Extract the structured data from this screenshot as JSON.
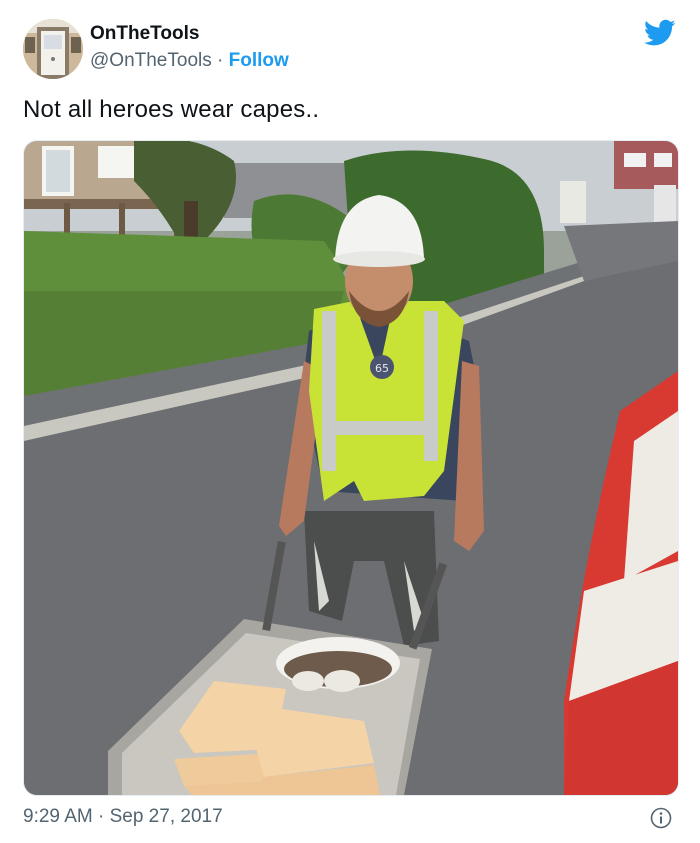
{
  "author": {
    "display_name": "OnTheTools",
    "handle": "@OnTheTools",
    "separator": "·",
    "follow_label": "Follow"
  },
  "tweet": {
    "text": "Not all heroes wear capes..",
    "timestamp": "9:29 AM · Sep 27, 2017"
  },
  "photo": {
    "vest_badge": "65"
  },
  "icons": {
    "brand": "twitter-bird-icon",
    "info": "info-icon"
  },
  "colors": {
    "accent": "#1d9bf0",
    "text_primary": "#0f1419",
    "text_secondary": "#536471"
  }
}
